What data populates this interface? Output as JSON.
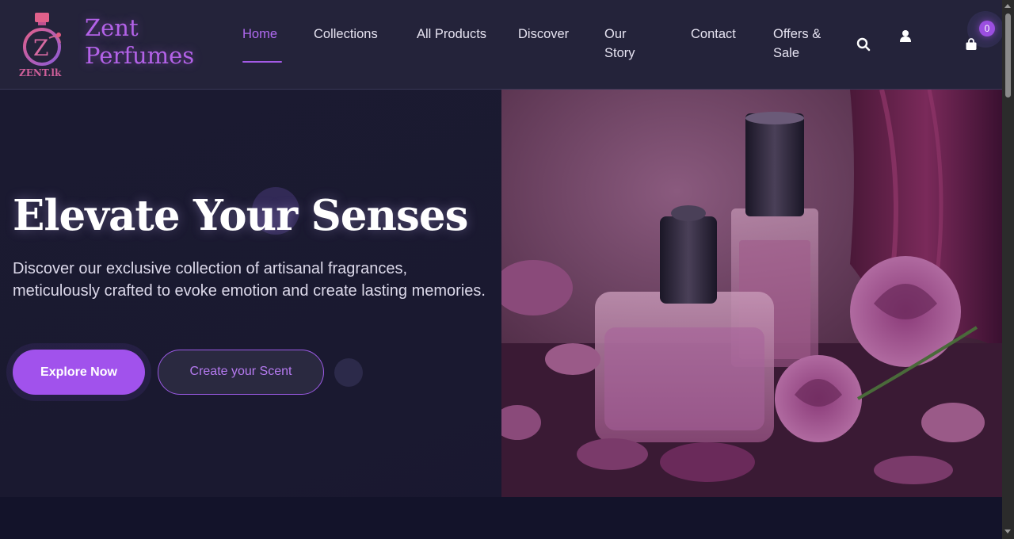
{
  "header": {
    "logo_text": "ZENT.lk",
    "brand_line1": "Zent",
    "brand_line2": "Perfumes",
    "nav": [
      {
        "label": "Home",
        "active": true
      },
      {
        "label": "Collections"
      },
      {
        "label": "All Products"
      },
      {
        "label": "Discover"
      },
      {
        "label": "Our Story"
      },
      {
        "label": "Contact"
      },
      {
        "label": "Offers & Sale"
      }
    ],
    "icons": [
      "search-icon",
      "user-icon",
      "cart-icon"
    ],
    "cart_count": "0"
  },
  "hero": {
    "title": "Elevate Your Senses",
    "description": "Discover our exclusive collection of artisanal fragrances, meticulously crafted to evoke emotion and create lasting memories.",
    "primary_button": "Explore Now",
    "secondary_button": "Create your Scent"
  },
  "colors": {
    "accent": "#a152ec",
    "header_bg": "#24233a",
    "hero_bg": "#1b1a31"
  }
}
